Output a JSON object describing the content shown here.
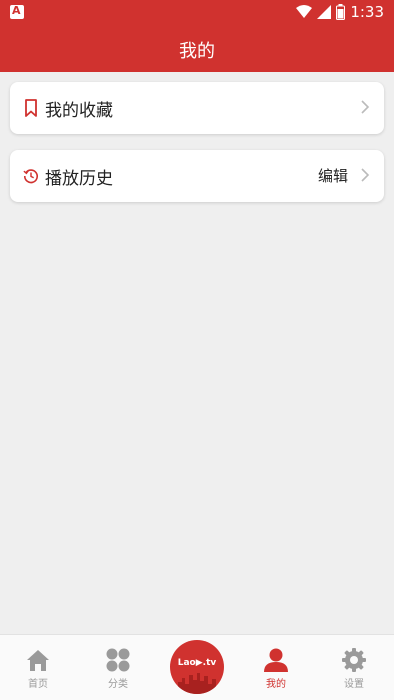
{
  "status_bar": {
    "time": "1:33"
  },
  "header": {
    "title": "我的"
  },
  "cards": [
    {
      "label": "我的收藏"
    },
    {
      "label": "播放历史",
      "action": "编辑"
    }
  ],
  "tabs": [
    {
      "label": "首页",
      "icon": "home-icon"
    },
    {
      "label": "分类",
      "icon": "category-icon"
    },
    {
      "label": "我的",
      "icon": "user-icon"
    },
    {
      "label": "设置",
      "icon": "settings-icon"
    }
  ],
  "center_button": {
    "brand": "Lao▶.tv"
  },
  "colors": {
    "accent": "#d0322f",
    "background": "#efefef",
    "inactive": "#9a9a9a"
  }
}
